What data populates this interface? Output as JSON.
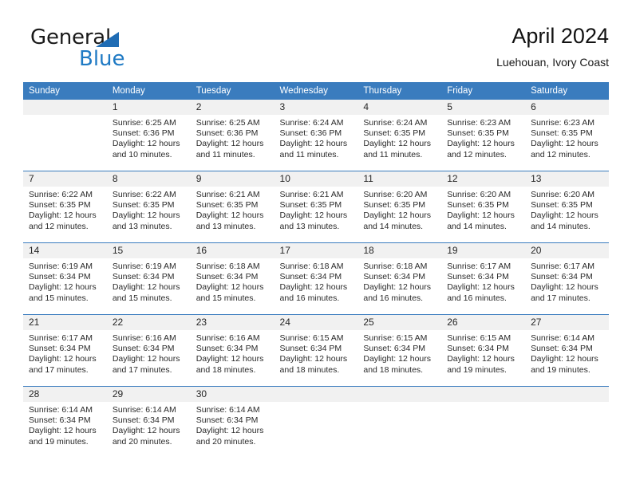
{
  "brand": {
    "name_part1": "General",
    "name_part2": "Blue",
    "triangle_icon": "blue-triangle-logo-mark"
  },
  "header": {
    "title": "April 2024",
    "subtitle": "Luehouan, Ivory Coast"
  },
  "colors": {
    "header_blue": "#3a7cbe",
    "brand_blue": "#1f7ac4",
    "daynum_band": "#f1f1f1",
    "text": "#2a2a2a"
  },
  "weekday_headers": [
    "Sunday",
    "Monday",
    "Tuesday",
    "Wednesday",
    "Thursday",
    "Friday",
    "Saturday"
  ],
  "weeks": [
    [
      {
        "day": "",
        "sunrise": "",
        "sunset": "",
        "daylight_line1": "",
        "daylight_line2": ""
      },
      {
        "day": "1",
        "sunrise": "Sunrise: 6:25 AM",
        "sunset": "Sunset: 6:36 PM",
        "daylight_line1": "Daylight: 12 hours",
        "daylight_line2": "and 10 minutes."
      },
      {
        "day": "2",
        "sunrise": "Sunrise: 6:25 AM",
        "sunset": "Sunset: 6:36 PM",
        "daylight_line1": "Daylight: 12 hours",
        "daylight_line2": "and 11 minutes."
      },
      {
        "day": "3",
        "sunrise": "Sunrise: 6:24 AM",
        "sunset": "Sunset: 6:36 PM",
        "daylight_line1": "Daylight: 12 hours",
        "daylight_line2": "and 11 minutes."
      },
      {
        "day": "4",
        "sunrise": "Sunrise: 6:24 AM",
        "sunset": "Sunset: 6:35 PM",
        "daylight_line1": "Daylight: 12 hours",
        "daylight_line2": "and 11 minutes."
      },
      {
        "day": "5",
        "sunrise": "Sunrise: 6:23 AM",
        "sunset": "Sunset: 6:35 PM",
        "daylight_line1": "Daylight: 12 hours",
        "daylight_line2": "and 12 minutes."
      },
      {
        "day": "6",
        "sunrise": "Sunrise: 6:23 AM",
        "sunset": "Sunset: 6:35 PM",
        "daylight_line1": "Daylight: 12 hours",
        "daylight_line2": "and 12 minutes."
      }
    ],
    [
      {
        "day": "7",
        "sunrise": "Sunrise: 6:22 AM",
        "sunset": "Sunset: 6:35 PM",
        "daylight_line1": "Daylight: 12 hours",
        "daylight_line2": "and 12 minutes."
      },
      {
        "day": "8",
        "sunrise": "Sunrise: 6:22 AM",
        "sunset": "Sunset: 6:35 PM",
        "daylight_line1": "Daylight: 12 hours",
        "daylight_line2": "and 13 minutes."
      },
      {
        "day": "9",
        "sunrise": "Sunrise: 6:21 AM",
        "sunset": "Sunset: 6:35 PM",
        "daylight_line1": "Daylight: 12 hours",
        "daylight_line2": "and 13 minutes."
      },
      {
        "day": "10",
        "sunrise": "Sunrise: 6:21 AM",
        "sunset": "Sunset: 6:35 PM",
        "daylight_line1": "Daylight: 12 hours",
        "daylight_line2": "and 13 minutes."
      },
      {
        "day": "11",
        "sunrise": "Sunrise: 6:20 AM",
        "sunset": "Sunset: 6:35 PM",
        "daylight_line1": "Daylight: 12 hours",
        "daylight_line2": "and 14 minutes."
      },
      {
        "day": "12",
        "sunrise": "Sunrise: 6:20 AM",
        "sunset": "Sunset: 6:35 PM",
        "daylight_line1": "Daylight: 12 hours",
        "daylight_line2": "and 14 minutes."
      },
      {
        "day": "13",
        "sunrise": "Sunrise: 6:20 AM",
        "sunset": "Sunset: 6:35 PM",
        "daylight_line1": "Daylight: 12 hours",
        "daylight_line2": "and 14 minutes."
      }
    ],
    [
      {
        "day": "14",
        "sunrise": "Sunrise: 6:19 AM",
        "sunset": "Sunset: 6:34 PM",
        "daylight_line1": "Daylight: 12 hours",
        "daylight_line2": "and 15 minutes."
      },
      {
        "day": "15",
        "sunrise": "Sunrise: 6:19 AM",
        "sunset": "Sunset: 6:34 PM",
        "daylight_line1": "Daylight: 12 hours",
        "daylight_line2": "and 15 minutes."
      },
      {
        "day": "16",
        "sunrise": "Sunrise: 6:18 AM",
        "sunset": "Sunset: 6:34 PM",
        "daylight_line1": "Daylight: 12 hours",
        "daylight_line2": "and 15 minutes."
      },
      {
        "day": "17",
        "sunrise": "Sunrise: 6:18 AM",
        "sunset": "Sunset: 6:34 PM",
        "daylight_line1": "Daylight: 12 hours",
        "daylight_line2": "and 16 minutes."
      },
      {
        "day": "18",
        "sunrise": "Sunrise: 6:18 AM",
        "sunset": "Sunset: 6:34 PM",
        "daylight_line1": "Daylight: 12 hours",
        "daylight_line2": "and 16 minutes."
      },
      {
        "day": "19",
        "sunrise": "Sunrise: 6:17 AM",
        "sunset": "Sunset: 6:34 PM",
        "daylight_line1": "Daylight: 12 hours",
        "daylight_line2": "and 16 minutes."
      },
      {
        "day": "20",
        "sunrise": "Sunrise: 6:17 AM",
        "sunset": "Sunset: 6:34 PM",
        "daylight_line1": "Daylight: 12 hours",
        "daylight_line2": "and 17 minutes."
      }
    ],
    [
      {
        "day": "21",
        "sunrise": "Sunrise: 6:17 AM",
        "sunset": "Sunset: 6:34 PM",
        "daylight_line1": "Daylight: 12 hours",
        "daylight_line2": "and 17 minutes."
      },
      {
        "day": "22",
        "sunrise": "Sunrise: 6:16 AM",
        "sunset": "Sunset: 6:34 PM",
        "daylight_line1": "Daylight: 12 hours",
        "daylight_line2": "and 17 minutes."
      },
      {
        "day": "23",
        "sunrise": "Sunrise: 6:16 AM",
        "sunset": "Sunset: 6:34 PM",
        "daylight_line1": "Daylight: 12 hours",
        "daylight_line2": "and 18 minutes."
      },
      {
        "day": "24",
        "sunrise": "Sunrise: 6:15 AM",
        "sunset": "Sunset: 6:34 PM",
        "daylight_line1": "Daylight: 12 hours",
        "daylight_line2": "and 18 minutes."
      },
      {
        "day": "25",
        "sunrise": "Sunrise: 6:15 AM",
        "sunset": "Sunset: 6:34 PM",
        "daylight_line1": "Daylight: 12 hours",
        "daylight_line2": "and 18 minutes."
      },
      {
        "day": "26",
        "sunrise": "Sunrise: 6:15 AM",
        "sunset": "Sunset: 6:34 PM",
        "daylight_line1": "Daylight: 12 hours",
        "daylight_line2": "and 19 minutes."
      },
      {
        "day": "27",
        "sunrise": "Sunrise: 6:14 AM",
        "sunset": "Sunset: 6:34 PM",
        "daylight_line1": "Daylight: 12 hours",
        "daylight_line2": "and 19 minutes."
      }
    ],
    [
      {
        "day": "28",
        "sunrise": "Sunrise: 6:14 AM",
        "sunset": "Sunset: 6:34 PM",
        "daylight_line1": "Daylight: 12 hours",
        "daylight_line2": "and 19 minutes."
      },
      {
        "day": "29",
        "sunrise": "Sunrise: 6:14 AM",
        "sunset": "Sunset: 6:34 PM",
        "daylight_line1": "Daylight: 12 hours",
        "daylight_line2": "and 20 minutes."
      },
      {
        "day": "30",
        "sunrise": "Sunrise: 6:14 AM",
        "sunset": "Sunset: 6:34 PM",
        "daylight_line1": "Daylight: 12 hours",
        "daylight_line2": "and 20 minutes."
      },
      {
        "day": "",
        "sunrise": "",
        "sunset": "",
        "daylight_line1": "",
        "daylight_line2": ""
      },
      {
        "day": "",
        "sunrise": "",
        "sunset": "",
        "daylight_line1": "",
        "daylight_line2": ""
      },
      {
        "day": "",
        "sunrise": "",
        "sunset": "",
        "daylight_line1": "",
        "daylight_line2": ""
      },
      {
        "day": "",
        "sunrise": "",
        "sunset": "",
        "daylight_line1": "",
        "daylight_line2": ""
      }
    ]
  ]
}
